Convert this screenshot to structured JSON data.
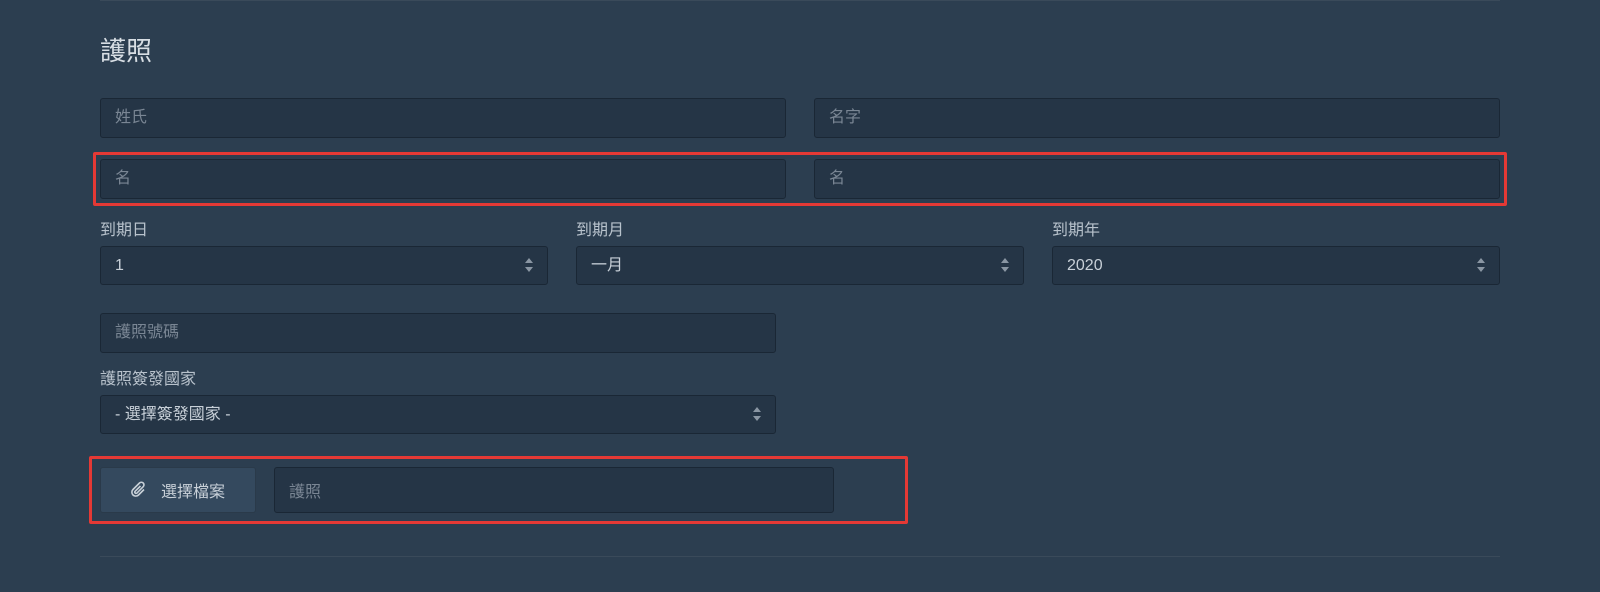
{
  "section": {
    "title": "護照"
  },
  "fields": {
    "surname": {
      "placeholder": "姓氏"
    },
    "givenname": {
      "placeholder": "名字"
    },
    "name1": {
      "placeholder": "名"
    },
    "name2": {
      "placeholder": "名"
    },
    "passport_number": {
      "placeholder": "護照號碼"
    }
  },
  "expiry": {
    "day": {
      "label": "到期日",
      "value": "1"
    },
    "month": {
      "label": "到期月",
      "value": "一月"
    },
    "year": {
      "label": "到期年",
      "value": "2020"
    }
  },
  "issuing_country": {
    "label": "護照簽發國家",
    "value": "- 選擇簽發國家 -"
  },
  "file": {
    "button_label": "選擇檔案",
    "display": "護照"
  }
}
